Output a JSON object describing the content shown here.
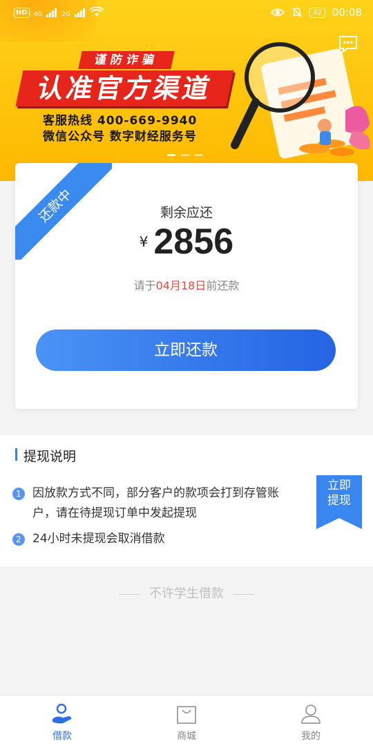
{
  "status_bar": {
    "hd": "HD",
    "net1": "4G",
    "net2": "2G",
    "battery": "42",
    "time": "00:08"
  },
  "banner": {
    "tag": "谨防诈骗",
    "headline": "认准官方渠道",
    "hotline": "客服热线 400-669-9940",
    "wechat": "微信公众号 数字财经服务号"
  },
  "loan_card": {
    "ribbon": "还款中",
    "remaining_label": "剩余应还",
    "currency": "¥",
    "amount": "2856",
    "due_prefix": "请于",
    "due_date": "04月18日",
    "due_suffix": "前还款",
    "pay_button": "立即还款"
  },
  "withdrawal": {
    "title": "提现说明",
    "items": [
      {
        "num": "1",
        "text": "因放款方式不同，部分客户的款项会打到存管账户，请在待提现订单中发起提现"
      },
      {
        "num": "2",
        "text": "24小时未提现会取消借款"
      }
    ],
    "flag": {
      "line1": "立即",
      "line2": "提现"
    }
  },
  "footer_note": "不许学生借款",
  "tabs": [
    {
      "label": "借款",
      "icon": "loan-hand-icon",
      "active": true
    },
    {
      "label": "商城",
      "icon": "shopping-bag-icon",
      "active": false
    },
    {
      "label": "我的",
      "icon": "user-icon",
      "active": false
    }
  ],
  "colors": {
    "accent": "#2f6fe4",
    "banner": "#ffc20b",
    "banner_red": "#e8251a",
    "due_date": "#e84a3a"
  }
}
